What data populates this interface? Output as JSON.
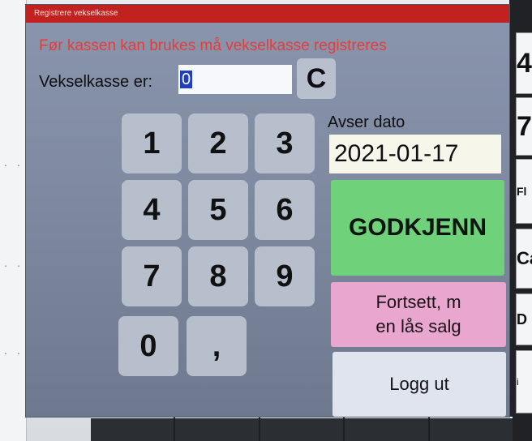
{
  "dialog": {
    "title": "Registrere vekselkasse",
    "warning": "Før kassen kan brukes må vekselkasse registreres",
    "float_label": "Vekselkasse er:",
    "float_value": "0",
    "clear_label": "C"
  },
  "keypad": {
    "keys": [
      "1",
      "2",
      "3",
      "4",
      "5",
      "6",
      "7",
      "8",
      "9",
      "0",
      ","
    ]
  },
  "date": {
    "label": "Avser dato",
    "value": "2021-01-17"
  },
  "actions": {
    "approve_label": "GODKJENN",
    "continue_line1": "Fortsett, m",
    "continue_line2": "en lås salg",
    "logout_label": "Logg ut"
  },
  "background": {
    "right_tiles": [
      "4",
      "7",
      "Fl",
      "Ca",
      "D",
      "i"
    ]
  },
  "colors": {
    "titlebar": "#c1211f",
    "warning_text": "#e33d3d",
    "approve": "#6fd17a",
    "continue": "#e9a7d0",
    "logout": "#dfe4ee",
    "dialog_bg": "#8a96ad"
  }
}
